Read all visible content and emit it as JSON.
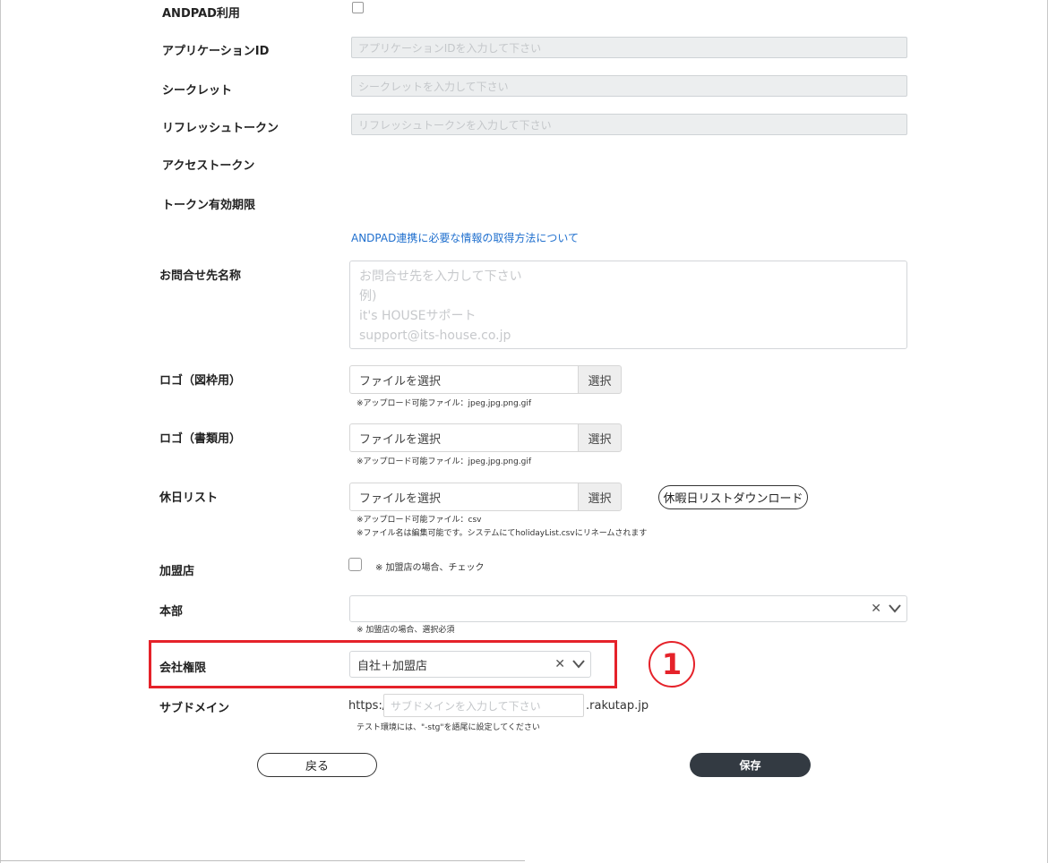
{
  "form": {
    "andpad": {
      "label": "ANDPAD利用",
      "checked": false
    },
    "app_id": {
      "label": "アプリケーションID",
      "placeholder": "アプリケーションIDを入力して下さい"
    },
    "secret": {
      "label": "シークレット",
      "placeholder": "シークレットを入力して下さい"
    },
    "refresh_token": {
      "label": "リフレッシュトークン",
      "placeholder": "リフレッシュトークンを入力して下さい"
    },
    "access_token": {
      "label": "アクセストークン"
    },
    "token_expiry": {
      "label": "トークン有効期限"
    },
    "andpad_help_link": "ANDPAD連携に必要な情報の取得方法について",
    "contact": {
      "label": "お問合せ先名称",
      "placeholder_lines": [
        "お問合せ先を入力して下さい",
        "例)",
        "it's HOUSEサポート",
        "support@its-house.co.jp"
      ]
    },
    "logo_frame": {
      "label": "ロゴ（図枠用）",
      "file_text": "ファイルを選択",
      "button": "選択",
      "note": "※アップロード可能ファイル：jpeg.jpg.png.gif"
    },
    "logo_docs": {
      "label": "ロゴ（書類用）",
      "file_text": "ファイルを選択",
      "button": "選択",
      "note": "※アップロード可能ファイル：jpeg.jpg.png.gif"
    },
    "holiday_list": {
      "label": "休日リスト",
      "file_text": "ファイルを選択",
      "button": "選択",
      "download_button": "休暇日リストダウンロード",
      "note1": "※アップロード可能ファイル：csv",
      "note2": "※ファイル名は編集可能です。システムにてholidayList.csvにリネームされます"
    },
    "franchise": {
      "label": "加盟店",
      "checked": false,
      "note": "※ 加盟店の場合、チェック"
    },
    "headquarters": {
      "label": "本部",
      "value": "",
      "note": "※ 加盟店の場合、選択必須"
    },
    "company_permission": {
      "label": "会社権限",
      "value": "自社＋加盟店"
    },
    "subdomain": {
      "label": "サブドメイン",
      "prefix": "https://",
      "placeholder": "サブドメインを入力して下さい",
      "suffix": ".rakutap.jp",
      "note": "テスト環境には、\"-stg\"を語尾に設定してください"
    }
  },
  "buttons": {
    "back": "戻る",
    "save": "保存"
  },
  "annotation": {
    "marker": "1",
    "color": "#e5222a"
  }
}
